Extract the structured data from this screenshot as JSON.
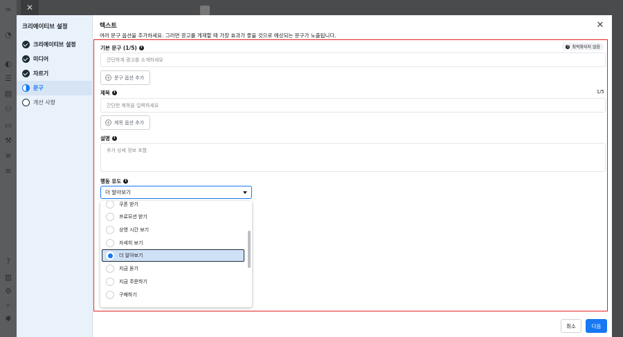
{
  "background": {
    "close_glyph": "✕"
  },
  "left_panel": {
    "title": "크리에이티브 설정",
    "steps": [
      {
        "label": "크리에이티브 설정",
        "state": "done"
      },
      {
        "label": "미디어",
        "state": "done"
      },
      {
        "label": "자르기",
        "state": "done"
      },
      {
        "label": "문구",
        "state": "active"
      },
      {
        "label": "개선 사항",
        "state": "todo"
      }
    ]
  },
  "header": {
    "title": "텍스트",
    "description": "여러 문구 옵션을 추가하세요. 그러면 광고를 게재할 때 가장 효과가 좋을 것으로 예상되는 문구가 노출됩니다.",
    "close_glyph": "✕"
  },
  "primary_text": {
    "label": "기본 문구 (1/5)",
    "badge": "최적화되지 않음",
    "placeholder": "간단하게 광고를 소개하세요",
    "add_button": "문구 옵션 추가"
  },
  "headline": {
    "label": "제목",
    "counter": "1/5",
    "placeholder": "간단한 제목을 입력하세요",
    "add_button": "제목 옵션 추가"
  },
  "description_field": {
    "label": "설명",
    "placeholder": "추가 상세 정보 포함"
  },
  "cta": {
    "label": "행동 유도",
    "selected": "더 알아보기",
    "options": [
      {
        "label": "쿠폰 받기",
        "selected": false
      },
      {
        "label": "프로모션 받기",
        "selected": false
      },
      {
        "label": "상영 시간 보기",
        "selected": false
      },
      {
        "label": "자세히 보기",
        "selected": false
      },
      {
        "label": "더 알아보기",
        "selected": true
      },
      {
        "label": "지금 듣기",
        "selected": false
      },
      {
        "label": "지금 주문하기",
        "selected": false
      },
      {
        "label": "구매하기",
        "selected": false
      }
    ]
  },
  "footer": {
    "cancel": "취소",
    "next": "다음"
  },
  "colors": {
    "accent": "#1877f2",
    "highlight_border": "#e02020",
    "selected_option_bg": "#cfe1f7"
  }
}
